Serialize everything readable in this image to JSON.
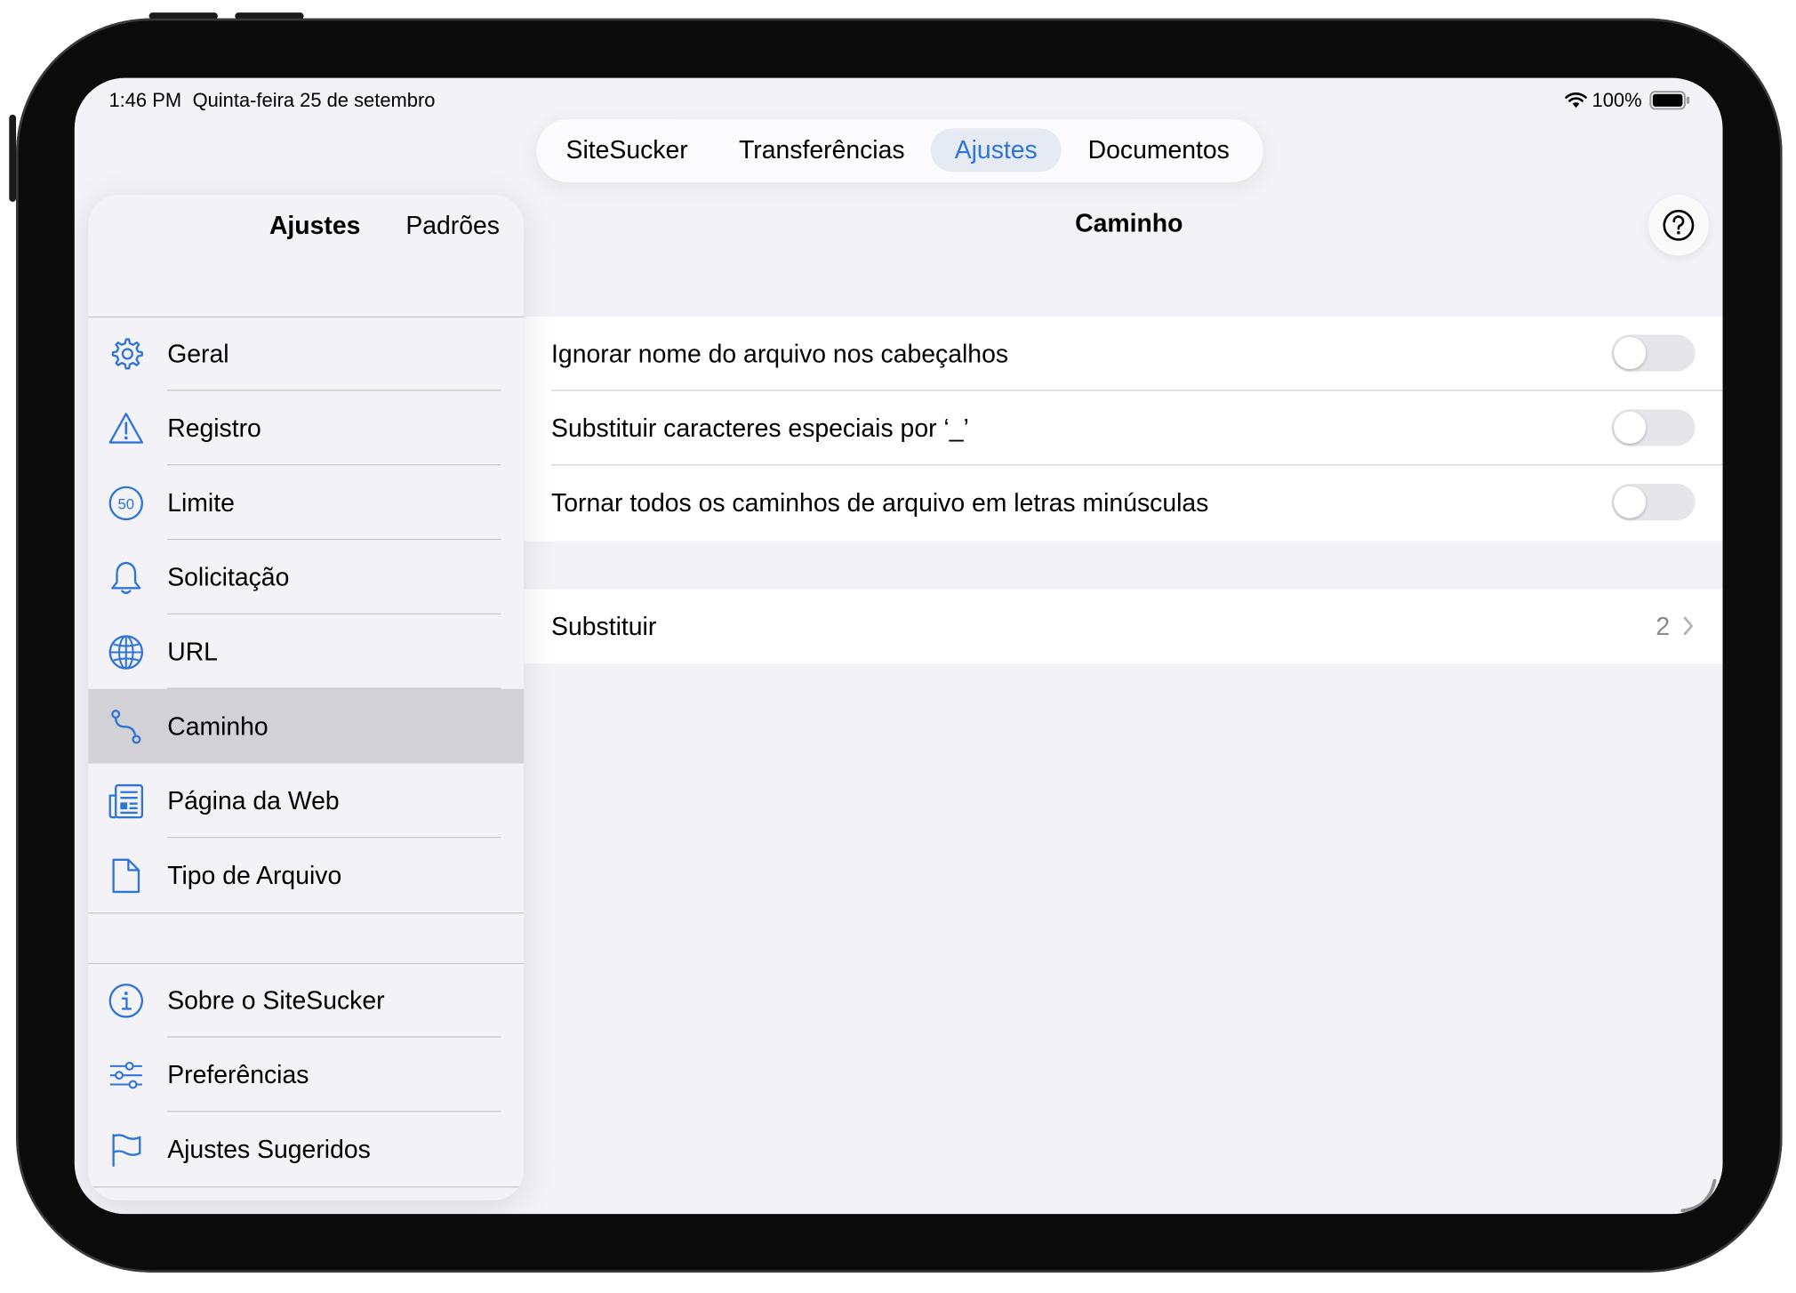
{
  "status_bar": {
    "time": "1:46 PM",
    "date": "Quinta-feira 25 de setembro",
    "battery": "100%"
  },
  "tabs": [
    {
      "label": "SiteSucker",
      "active": false
    },
    {
      "label": "Transferências",
      "active": false
    },
    {
      "label": "Ajustes",
      "active": true
    },
    {
      "label": "Documentos",
      "active": false
    }
  ],
  "sidebar": {
    "segments": [
      "Ajustes",
      "Padrões"
    ],
    "items": [
      {
        "label": "Geral",
        "icon": "gear-icon"
      },
      {
        "label": "Registro",
        "icon": "warning-triangle-icon"
      },
      {
        "label": "Limite",
        "icon": "limit-50-icon"
      },
      {
        "label": "Solicitação",
        "icon": "bell-icon"
      },
      {
        "label": "URL",
        "icon": "globe-icon"
      },
      {
        "label": "Caminho",
        "icon": "path-icon",
        "selected": true
      },
      {
        "label": "Página da Web",
        "icon": "newspaper-icon"
      },
      {
        "label": "Tipo de Arquivo",
        "icon": "document-icon"
      }
    ],
    "items2": [
      {
        "label": "Sobre o SiteSucker",
        "icon": "info-icon"
      },
      {
        "label": "Preferências",
        "icon": "sliders-icon"
      },
      {
        "label": "Ajustes Sugeridos",
        "icon": "flag-icon"
      }
    ]
  },
  "detail": {
    "title": "Caminho",
    "toggles": [
      {
        "label": "Ignorar nome do arquivo nos cabeçalhos",
        "on": false
      },
      {
        "label": "Substituir caracteres especiais por ‘_’",
        "on": false
      },
      {
        "label": "Tornar todos os caminhos de arquivo em letras minúsculas",
        "on": false
      }
    ],
    "replace": {
      "label": "Substituir",
      "value": "2"
    }
  },
  "colors": {
    "accent": "#2f74d8",
    "background": "#f2f2f7",
    "toggle_off": "#e5e5ea"
  }
}
